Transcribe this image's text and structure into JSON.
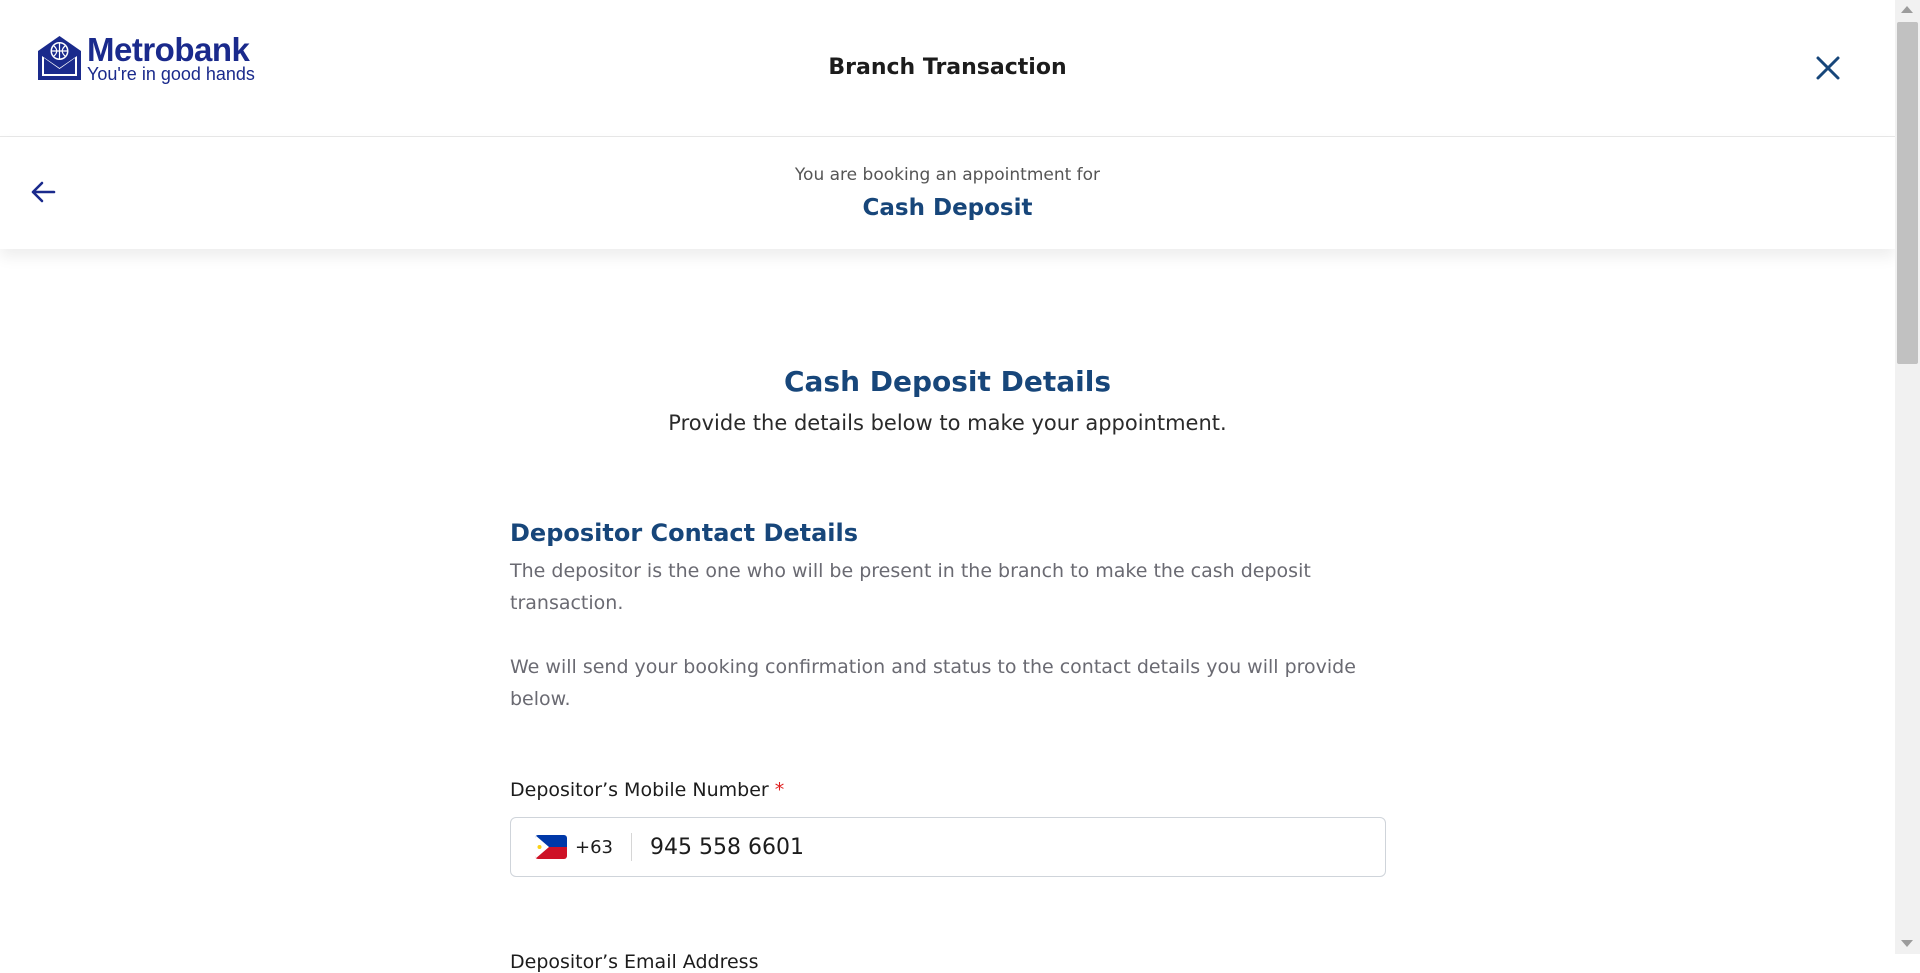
{
  "header": {
    "logo_name": "Metrobank",
    "logo_tagline": "You're in good hands",
    "title": "Branch Transaction",
    "close_icon": "close-icon"
  },
  "subheader": {
    "intro": "You are booking an appointment for",
    "transaction": "Cash Deposit",
    "back_icon": "arrow-left-icon"
  },
  "main": {
    "title": "Cash Deposit Details",
    "subtitle": "Provide the details below to make your appointment."
  },
  "section": {
    "title": "Depositor Contact Details",
    "description": "The depositor is the one who will be present in the branch to make the cash deposit transaction.",
    "description2": "We will send your booking confirmation and status to the contact details you will provide below."
  },
  "mobile": {
    "label": "Depositor’s Mobile Number",
    "required_mark": "*",
    "country_code": "+63",
    "value": "945 558 6601",
    "flag_icon": "philippines-flag-icon"
  },
  "email": {
    "label": "Depositor’s Email Address"
  },
  "colors": {
    "brand_blue": "#1a2a8c",
    "heading_blue": "#17467a",
    "required_red": "#e02020"
  }
}
